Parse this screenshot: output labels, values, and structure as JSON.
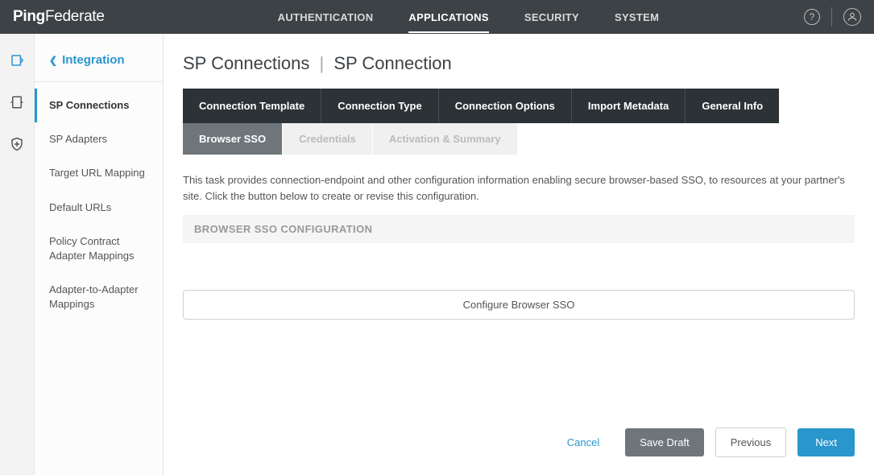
{
  "logo": {
    "text": "PingFederate",
    "bold_prefix": "Ping",
    "light_suffix": "Federate"
  },
  "nav": {
    "items": [
      {
        "label": "AUTHENTICATION",
        "active": false
      },
      {
        "label": "APPLICATIONS",
        "active": true
      },
      {
        "label": "SECURITY",
        "active": false
      },
      {
        "label": "SYSTEM",
        "active": false
      }
    ]
  },
  "sidebar": {
    "title": "Integration",
    "items": [
      {
        "label": "SP Connections",
        "active": true
      },
      {
        "label": "SP Adapters",
        "active": false
      },
      {
        "label": "Target URL Mapping",
        "active": false
      },
      {
        "label": "Default URLs",
        "active": false
      },
      {
        "label": "Policy Contract Adapter Mappings",
        "active": false
      },
      {
        "label": "Adapter-to-Adapter Mappings",
        "active": false
      }
    ]
  },
  "breadcrumb": {
    "parent": "SP Connections",
    "current": "SP Connection"
  },
  "tabs_row1": [
    {
      "label": "Connection Template"
    },
    {
      "label": "Connection Type"
    },
    {
      "label": "Connection Options"
    },
    {
      "label": "Import Metadata"
    },
    {
      "label": "General Info"
    }
  ],
  "tabs_row2": [
    {
      "label": "Browser SSO",
      "active": true
    },
    {
      "label": "Credentials",
      "active": false
    },
    {
      "label": "Activation & Summary",
      "active": false
    }
  ],
  "description": "This task provides connection-endpoint and other configuration information enabling secure browser-based SSO, to resources at your partner's site. Click the button below to create or revise this configuration.",
  "section_header": "BROWSER SSO CONFIGURATION",
  "configure_button": "Configure Browser SSO",
  "footer": {
    "cancel": "Cancel",
    "save_draft": "Save Draft",
    "previous": "Previous",
    "next": "Next"
  }
}
